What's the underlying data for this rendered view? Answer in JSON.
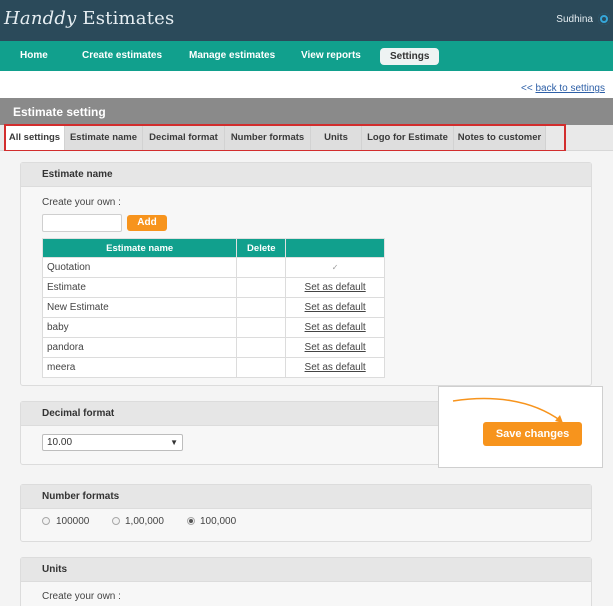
{
  "app": {
    "logo_script": "Handdy",
    "logo_text": "Estimates",
    "user": "Sudhina"
  },
  "nav": {
    "items": [
      "Home",
      "Create estimates",
      "Manage estimates",
      "View reports",
      "Settings"
    ],
    "active": "Settings"
  },
  "back_link": {
    "arrows": "<<",
    "label": "back to settings"
  },
  "page_title": "Estimate setting",
  "tabs": [
    "All settings",
    "Estimate name",
    "Decimal format",
    "Number formats",
    "Units",
    "Logo for Estimate",
    "Notes to customer"
  ],
  "estimate_name": {
    "heading": "Estimate name",
    "create_label": "Create your own :",
    "input_value": "",
    "add_label": "Add",
    "columns": [
      "Estimate name",
      "Delete",
      ""
    ],
    "rows": [
      {
        "name": "Quotation",
        "action": "✓",
        "is_default": true
      },
      {
        "name": "Estimate",
        "action": "Set as default",
        "is_default": false
      },
      {
        "name": "New Estimate",
        "action": "Set as default",
        "is_default": false
      },
      {
        "name": "baby",
        "action": "Set as default",
        "is_default": false
      },
      {
        "name": "pandora",
        "action": "Set as default",
        "is_default": false
      },
      {
        "name": "meera",
        "action": "Set as default",
        "is_default": false
      }
    ]
  },
  "decimal_format": {
    "heading": "Decimal format",
    "selected": "10.00"
  },
  "number_formats": {
    "heading": "Number formats",
    "options": [
      {
        "label": "100000",
        "checked": false
      },
      {
        "label": "1,00,000",
        "checked": false
      },
      {
        "label": "100,000",
        "checked": true
      }
    ]
  },
  "units": {
    "heading": "Units",
    "create_label": "Create your own :"
  },
  "save_button": "Save changes",
  "colors": {
    "topbar": "#2b4a5a",
    "nav": "#11a08d",
    "accent": "#f7941d",
    "highlight": "#d22d2d"
  }
}
